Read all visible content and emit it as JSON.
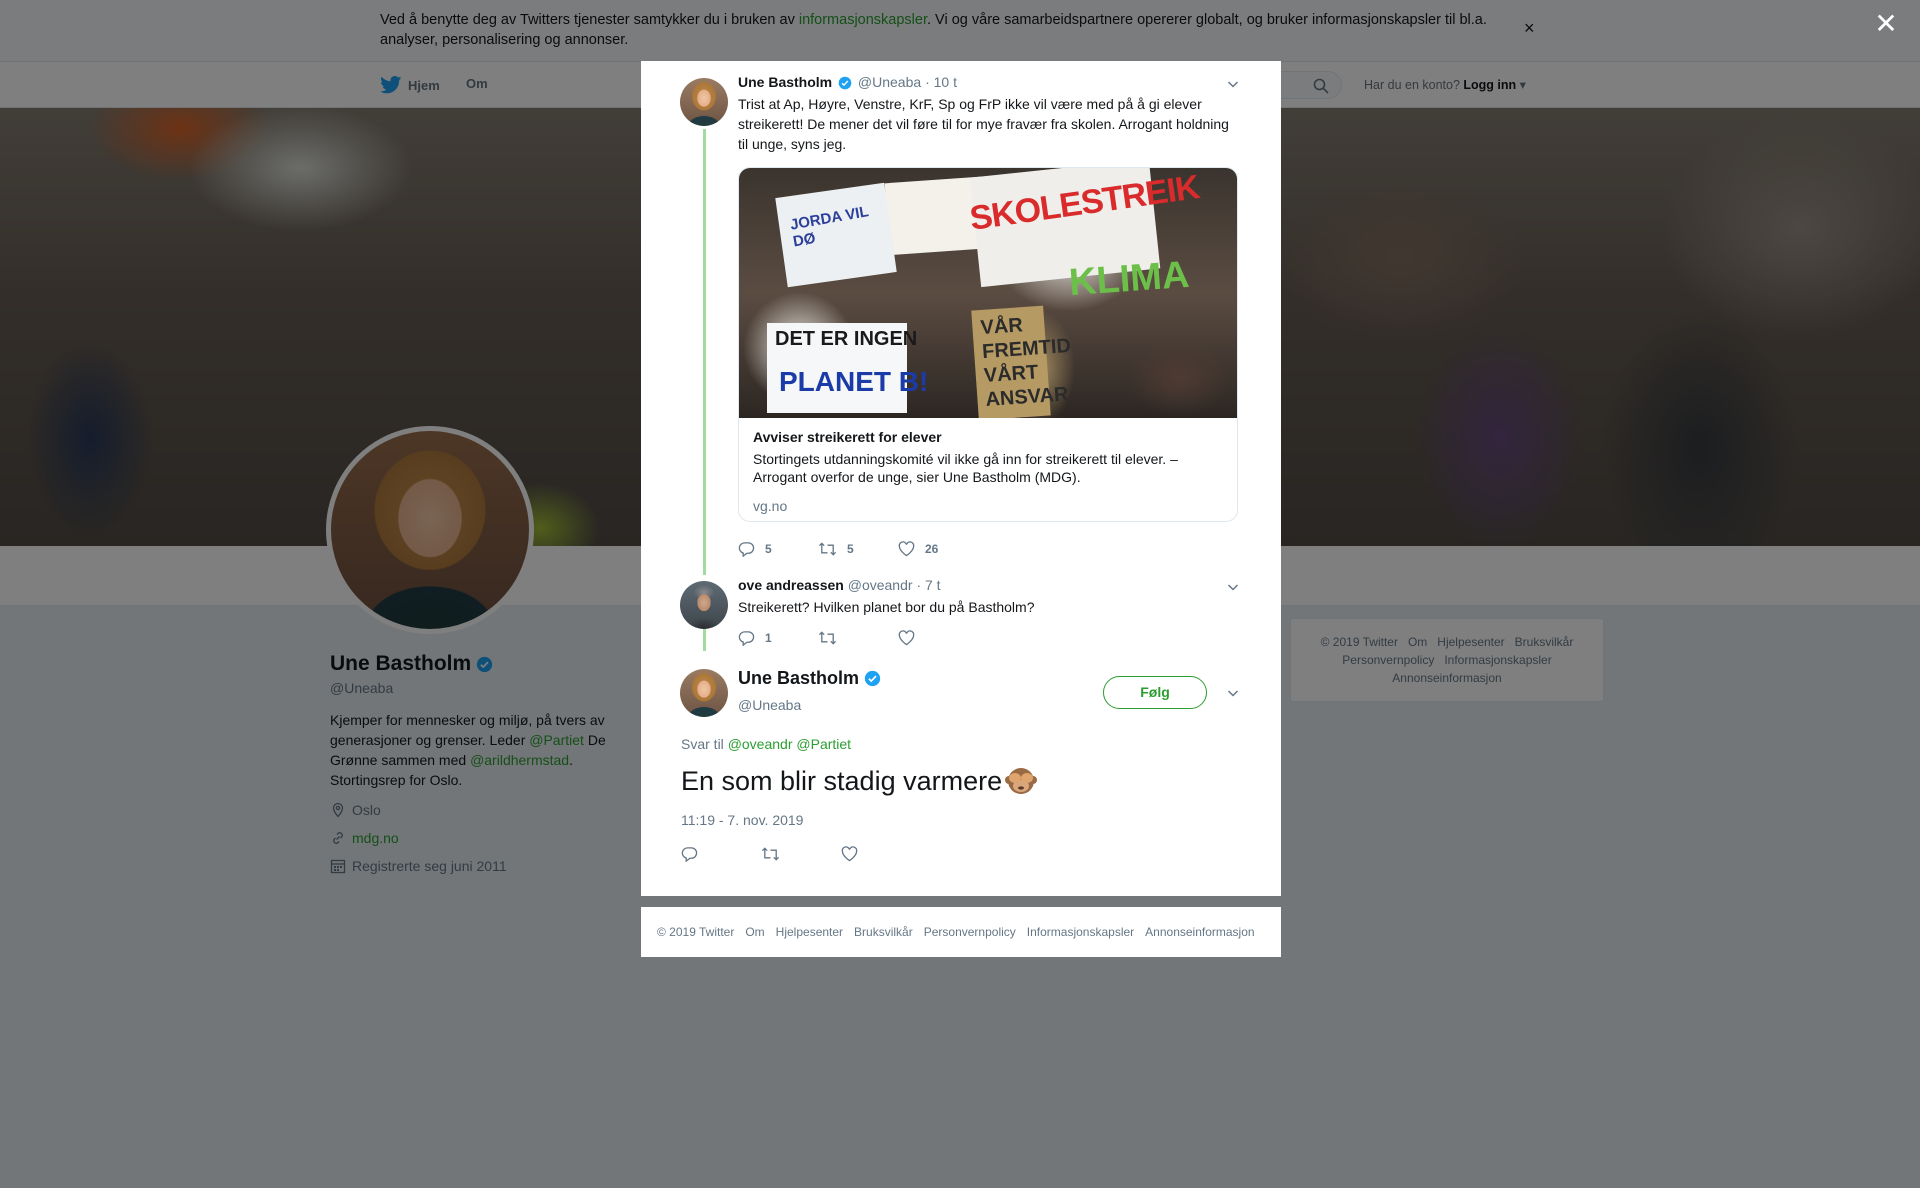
{
  "cookie": {
    "text_before": "Ved å benytte deg av Twitters tjenester samtykker du i bruken av ",
    "link": "informasjonskapsler",
    "text_after": ". Vi og våre samarbeidspartnere opererer globalt, og bruker informasjonskapsler til bl.a. analyser, personalisering og annonser.",
    "close": "×"
  },
  "nav": {
    "home": "Hjem",
    "about": "Om",
    "login_prompt": "Har du en konto?",
    "login": "Logg inn"
  },
  "profile": {
    "name": "Une Bastholm",
    "handle": "@Uneaba",
    "bio_1": "Kjemper for mennesker og miljø, på tvers av generasjoner og grenser. Leder ",
    "bio_link_1": "@Partiet",
    "bio_2": " De Grønne sammen med ",
    "bio_link_2": "@arildhermstad",
    "bio_3": ". Stortingsrep for Oslo.",
    "location": "Oslo",
    "website": "mdg.no",
    "joined": "Registrerte seg juni 2011"
  },
  "side_footer": {
    "items": [
      "© 2019 Twitter",
      "Om",
      "Hjelpesenter",
      "Bruksvilkår",
      "Personvernpolicy",
      "Informasjonskapsler",
      "Annonseinformasjon"
    ]
  },
  "overlay_close": "✕",
  "tweets": {
    "first": {
      "name": "Une Bastholm",
      "handle": "@Uneaba",
      "time": "· 10 t",
      "text": "Trist at Ap, Høyre, Venstre, KrF, Sp og FrP ikke vil være med på å gi elever streikerett! De mener det vil føre til for mye fravær fra skolen. Arrogant holdning til unge, syns jeg.",
      "card": {
        "title": "Avviser streikerett for elever",
        "description": "Stortingets utdanningskomité vil ikke gå inn for streikerett til elever. – Arrogant overfor de unge, sier Une Bastholm (MDG).",
        "domain": "vg.no",
        "signs": [
          "SKOLESTREIK",
          "JORDA VIL DØ",
          "DET ER INGEN",
          "PLANET B!",
          "VÅR FREMTID VÅRT ANSVAR",
          "KLIMA"
        ]
      },
      "replies": "5",
      "retweets": "5",
      "likes": "26"
    },
    "second": {
      "name": "ove andreassen",
      "handle": "@oveandr",
      "time": "· 7 t",
      "text": "Streikerett? Hvilken planet bor du på Bastholm?",
      "replies": "1"
    },
    "main": {
      "name": "Une Bastholm",
      "handle": "@Uneaba",
      "follow": "Følg",
      "reply_prefix": "Svar til ",
      "reply_link_1": "@oveandr",
      "reply_link_2": "@Partiet",
      "text": "En som blir stadig varmere",
      "timestamp": "11:19 - 7. nov. 2019"
    }
  },
  "modal_footer": {
    "items": [
      "© 2019 Twitter",
      "Om",
      "Hjelpesenter",
      "Bruksvilkår",
      "Personvernpolicy",
      "Informasjonskapsler",
      "Annonseinformasjon"
    ]
  },
  "colors": {
    "accent": "#2b9e31",
    "verified": "#1da1f2",
    "thread_line": "#a2dba0",
    "muted": "#657786"
  },
  "icons": [
    "twitter-bird-icon",
    "search-icon",
    "verified-icon",
    "location-icon",
    "link-icon",
    "calendar-icon",
    "chevron-down-icon",
    "reply-icon",
    "retweet-icon",
    "like-icon",
    "close-icon",
    "see-no-evil-monkey-emoji"
  ]
}
